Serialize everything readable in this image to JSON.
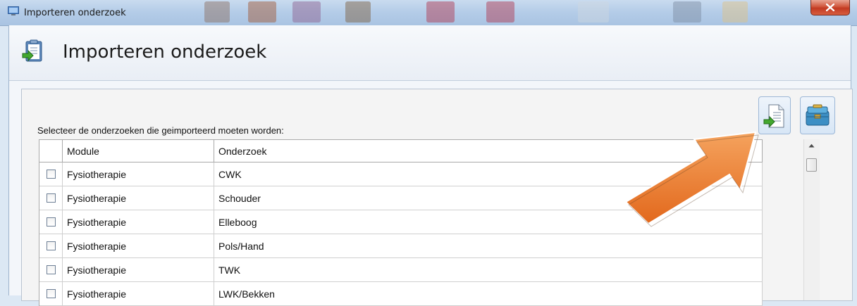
{
  "window": {
    "title": "Importeren onderzoek",
    "close_label": "X"
  },
  "header": {
    "title": "Importeren onderzoek"
  },
  "panel": {
    "instruction": "Selecteer de onderzoeken die geimporteerd moeten worden:"
  },
  "grid": {
    "columns": {
      "module": "Module",
      "onderzoek": "Onderzoek"
    },
    "rows": [
      {
        "module": "Fysiotherapie",
        "onderzoek": "CWK",
        "checked": false
      },
      {
        "module": "Fysiotherapie",
        "onderzoek": "Schouder",
        "checked": false
      },
      {
        "module": "Fysiotherapie",
        "onderzoek": "Elleboog",
        "checked": false
      },
      {
        "module": "Fysiotherapie",
        "onderzoek": "Pols/Hand",
        "checked": false
      },
      {
        "module": "Fysiotherapie",
        "onderzoek": "TWK",
        "checked": false
      },
      {
        "module": "Fysiotherapie",
        "onderzoek": "LWK/Bekken",
        "checked": false
      }
    ]
  },
  "toolbar": {
    "import_icon": "import-document-icon",
    "toolbox_icon": "toolbox-icon"
  },
  "colors": {
    "arrow": "#ec7a2c",
    "close_button": "#c94a31",
    "titlebar": "#b5cde8"
  }
}
